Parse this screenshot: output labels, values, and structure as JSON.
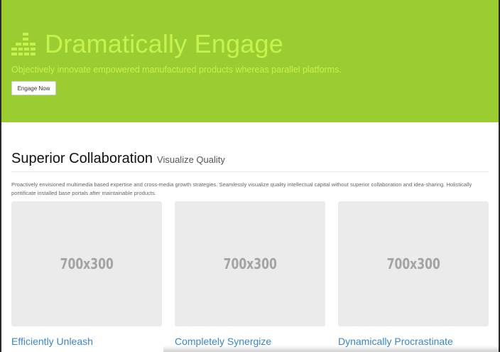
{
  "hero": {
    "title": "Dramatically Engage",
    "subtitle": "Objectively innovate empowered manufactured products whereas parallel platforms.",
    "button_label": "Engage Now",
    "background_color": "#9acd32",
    "text_color": "#c6f24d",
    "logo_icon": "bars-logo-icon"
  },
  "section": {
    "title": "Superior Collaboration",
    "subtitle": "Visualize Quality",
    "description": "Proactively envisioned multimedia based expertise and cross-media growth strategies. Seamlessly visualize quality intellectual capital without superior collaboration and idea-sharing. Holistically pontificate installed base portals after maintainable products."
  },
  "cards": [
    {
      "placeholder": "700x300",
      "title": "Efficiently Unleash"
    },
    {
      "placeholder": "700x300",
      "title": "Completely Synergize"
    },
    {
      "placeholder": "700x300",
      "title": "Dynamically Procrastinate"
    }
  ],
  "link_color": "#3a86c8"
}
